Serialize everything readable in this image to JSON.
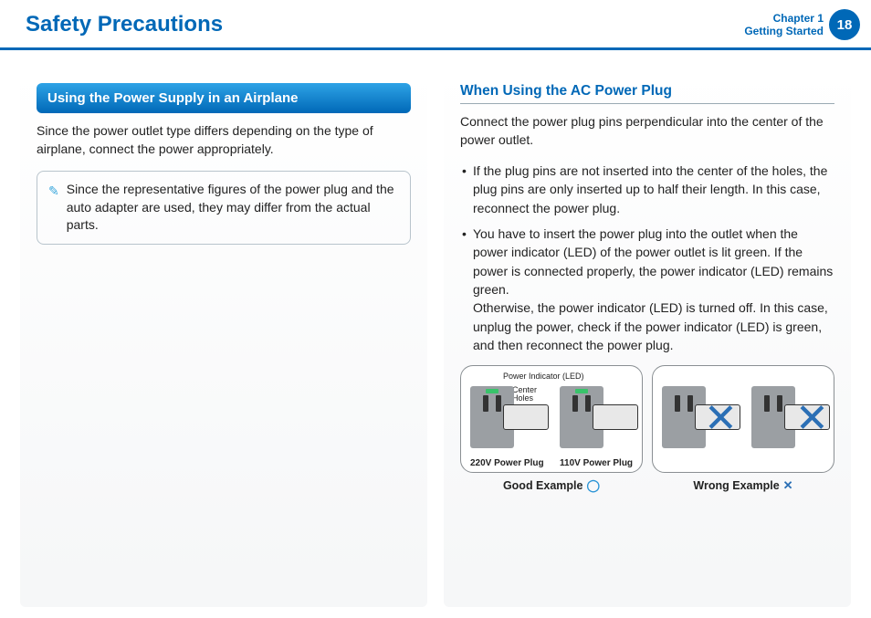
{
  "header": {
    "title": "Safety Precautions",
    "chapter_line1": "Chapter 1",
    "chapter_line2": "Getting Started",
    "page": "18"
  },
  "left": {
    "blue_heading": "Using the Power Supply in an Airplane",
    "intro": "Since the power outlet type differs depending on the type of airplane, connect the power appropriately.",
    "note": "Since the representative figures of the power plug and the auto adapter are used, they may differ from the actual parts."
  },
  "right": {
    "subheading": "When Using the AC Power Plug",
    "para": "Connect the power plug pins perpendicular into the center of the power outlet.",
    "bullet1": "If the plug pins are not inserted into the center of the holes, the plug pins are only inserted up to half their length. In this case, reconnect the power plug.",
    "bullet2": "You have to insert the power plug into the outlet when the power indicator (LED) of the power outlet is lit green. If the power is connected properly, the power indicator (LED) remains green.\nOtherwise, the power indicator (LED) is turned off. In this case, unplug the power, check if the power indicator (LED) is green, and then reconnect the power plug.",
    "labels": {
      "power_indicator": "Power Indicator (LED)",
      "center_holes": "Center\nHoles",
      "v220": "220V Power Plug",
      "v110": "110V Power Plug"
    },
    "good_example": "Good Example",
    "wrong_example": "Wrong Example"
  }
}
